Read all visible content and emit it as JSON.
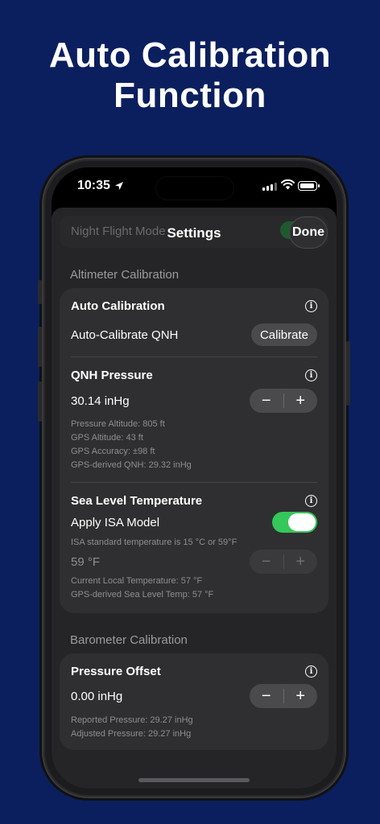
{
  "promo": {
    "title_line1": "Auto Calibration",
    "title_line2": "Function"
  },
  "status_bar": {
    "time": "10:35",
    "icons": [
      "location-arrow-icon",
      "cellular-signal-icon",
      "wifi-icon",
      "battery-icon"
    ]
  },
  "background_row": {
    "label": "Night Flight Mode"
  },
  "nav": {
    "title": "Settings",
    "done_label": "Done"
  },
  "altimeter": {
    "section_title": "Altimeter Calibration",
    "auto_calibration": {
      "title": "Auto Calibration",
      "row_label": "Auto-Calibrate QNH",
      "button_label": "Calibrate"
    },
    "qnh": {
      "title": "QNH Pressure",
      "value": "30.14 inHg",
      "minus": "−",
      "plus": "+",
      "details": [
        "Pressure Altitude: 805 ft",
        "GPS Altitude: 43 ft",
        "GPS Accuracy: ±98 ft",
        "GPS-derived QNH: 29.32 inHg"
      ]
    },
    "sea_level_temp": {
      "title": "Sea Level Temperature",
      "toggle_label": "Apply ISA Model",
      "toggle_on": true,
      "isa_note": "ISA standard temperature is 15 °C or 59°F",
      "value": "59 °F",
      "minus": "−",
      "plus": "+",
      "details": [
        "Current Local Temperature: 57 °F",
        "GPS-derived Sea Level Temp: 57 °F"
      ]
    }
  },
  "barometer": {
    "section_title": "Barometer Calibration",
    "pressure_offset": {
      "title": "Pressure Offset",
      "value": "0.00 inHg",
      "minus": "−",
      "plus": "+",
      "details": [
        "Reported Pressure: 29.27 inHg",
        "Adjusted Pressure: 29.27 inHg"
      ]
    }
  },
  "colors": {
    "background": "#0b1f5e",
    "toggle_on": "#34c759",
    "card": "#2f2f31",
    "sheet": "#252527"
  }
}
